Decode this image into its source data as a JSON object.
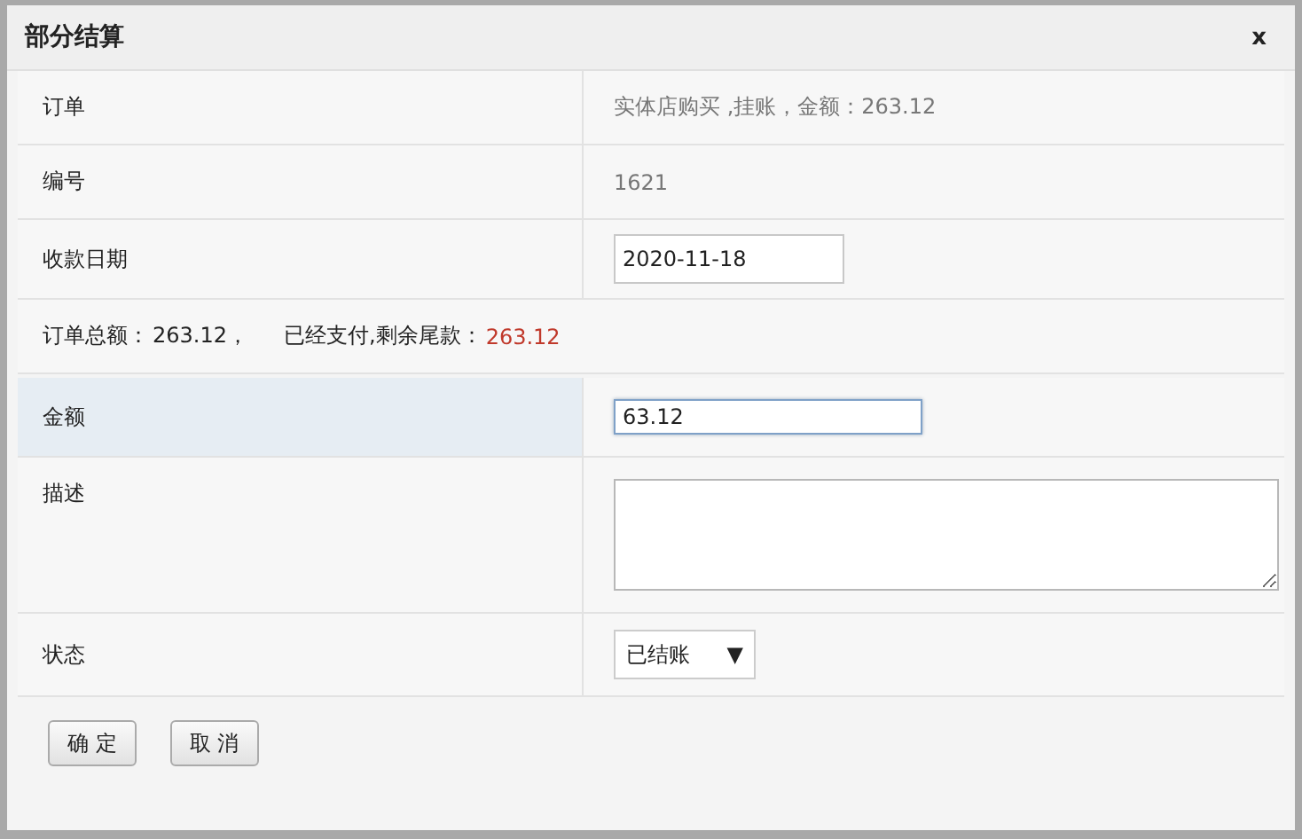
{
  "dialog": {
    "title": "部分结算",
    "close": "x"
  },
  "rows": [
    {
      "kind": "text",
      "label": "订单",
      "value": "实体店购买 ,挂账，金额：263.12"
    },
    {
      "kind": "text",
      "label": "编号",
      "value": "1621"
    },
    {
      "kind": "input",
      "label": "收款日期",
      "value": "2020-11-18",
      "focused": false,
      "highlighted": false
    },
    {
      "kind": "summary",
      "parts": [
        {
          "text": "订单总额：",
          "alert": false
        },
        {
          "text": "263.12，",
          "alert": false
        },
        {
          "text": "已经支付,剩余尾款：",
          "alert": false
        },
        {
          "text": "263.12",
          "alert": true
        }
      ]
    },
    {
      "kind": "input",
      "label": "金额",
      "value": "63.12",
      "focused": true,
      "highlighted": true
    },
    {
      "kind": "textarea",
      "label": "描述"
    },
    {
      "kind": "select",
      "label": "状态",
      "value": "已结账",
      "arrow": "▼"
    }
  ],
  "buttons": [
    "确 定",
    "取 消"
  ]
}
